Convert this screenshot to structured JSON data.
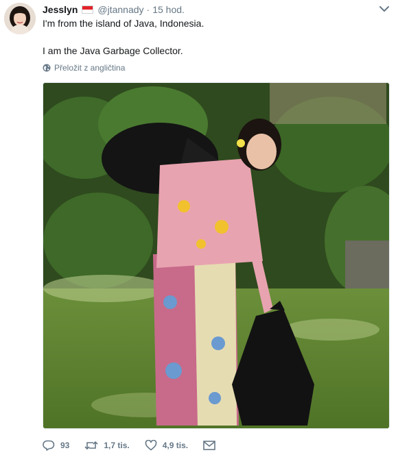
{
  "tweet": {
    "author_name": "Jesslyn",
    "handle": "@jtannady",
    "separator": "·",
    "time": "15 hod.",
    "text_lines": [
      "I'm from the island of Java, Indonesia.",
      "I am the Java Garbage Collector."
    ],
    "translate_label": "Přeložit z angličtina",
    "icons": {
      "flag": "indonesia-flag-icon",
      "caret": "chevron-down-icon",
      "globe": "globe-icon",
      "reply": "reply-icon",
      "retweet": "retweet-icon",
      "like": "heart-icon",
      "dm": "envelope-icon"
    },
    "actions": {
      "reply_count": "93",
      "retweet_count": "1,7 tis.",
      "like_count": "4,9 tis."
    }
  },
  "colors": {
    "text": "#14171a",
    "muted": "#657786",
    "flag_red": "#e2232a"
  }
}
